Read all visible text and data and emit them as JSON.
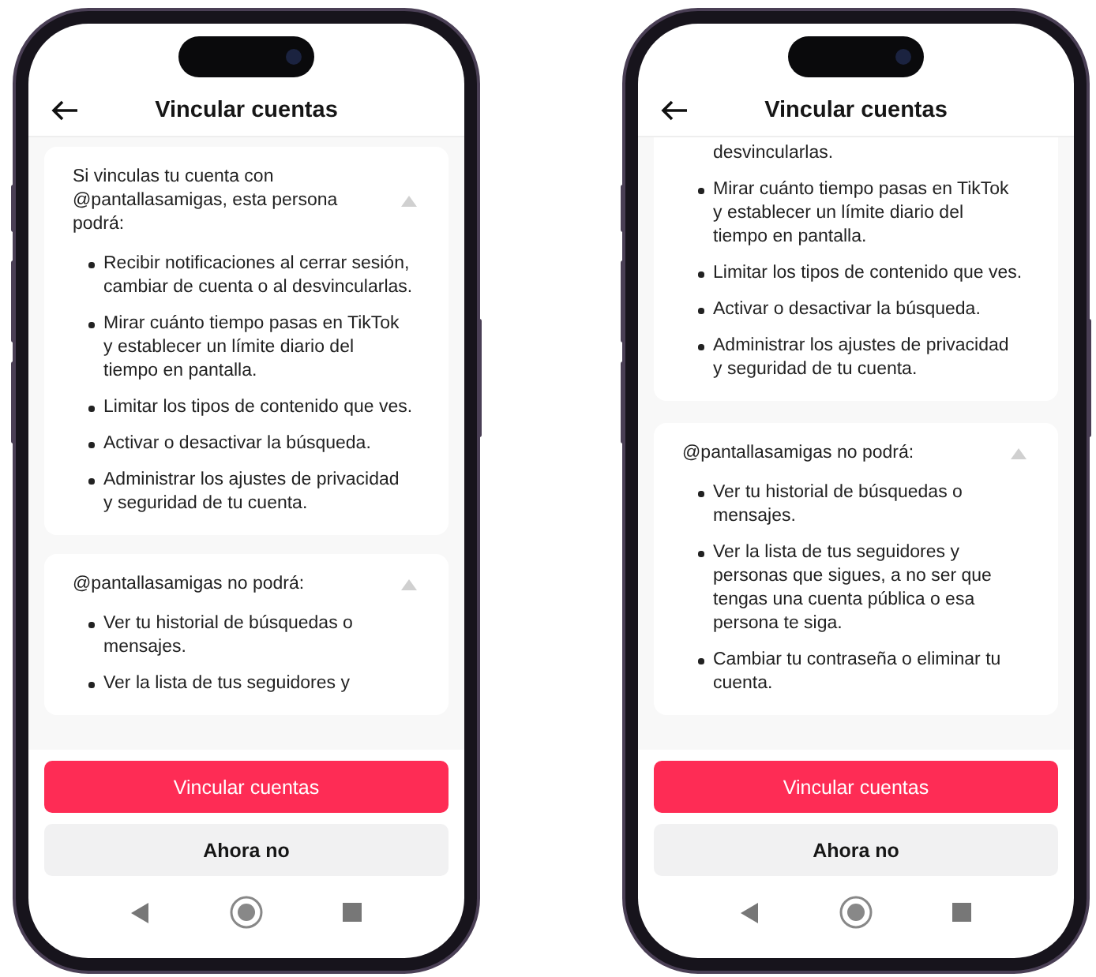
{
  "phones": [
    {
      "title": "Vincular cuentas",
      "sections": [
        {
          "heading": "Si vinculas tu cuenta con @pantallasamigas, esta persona podrá:",
          "expanded": true,
          "items": [
            "Recibir notificaciones al cerrar sesión, cambiar de cuenta o al desvincularlas.",
            "Mirar cuánto tiempo pasas en TikTok y establecer un límite diario del tiempo en pantalla.",
            "Limitar los tipos de contenido que ves.",
            "Activar o desactivar la búsqueda.",
            "Administrar los ajustes de privacidad y seguridad de tu cuenta."
          ]
        },
        {
          "heading": "@pantallasamigas no podrá:",
          "expanded": true,
          "items": [
            "Ver tu historial de búsquedas o mensajes.",
            "Ver la lista de tus seguidores y"
          ]
        }
      ],
      "primary_button": "Vincular cuentas",
      "secondary_button": "Ahora no"
    },
    {
      "title": "Vincular cuentas",
      "sections": [
        {
          "lead_in": "desvincularlas.",
          "items": [
            "Mirar cuánto tiempo pasas en TikTok y establecer un límite diario del tiempo en pantalla.",
            "Limitar los tipos de contenido que ves.",
            "Activar o desactivar la búsqueda.",
            "Administrar los ajustes de privacidad y seguridad de tu cuenta."
          ]
        },
        {
          "heading": "@pantallasamigas no podrá:",
          "expanded": true,
          "items": [
            "Ver tu historial de búsquedas o mensajes.",
            "Ver la lista de tus seguidores y personas que sigues, a no ser que tengas una cuenta pública o esa persona te siga.",
            "Cambiar tu contraseña o eliminar tu cuenta."
          ]
        }
      ],
      "primary_button": "Vincular cuentas",
      "secondary_button": "Ahora no"
    }
  ]
}
